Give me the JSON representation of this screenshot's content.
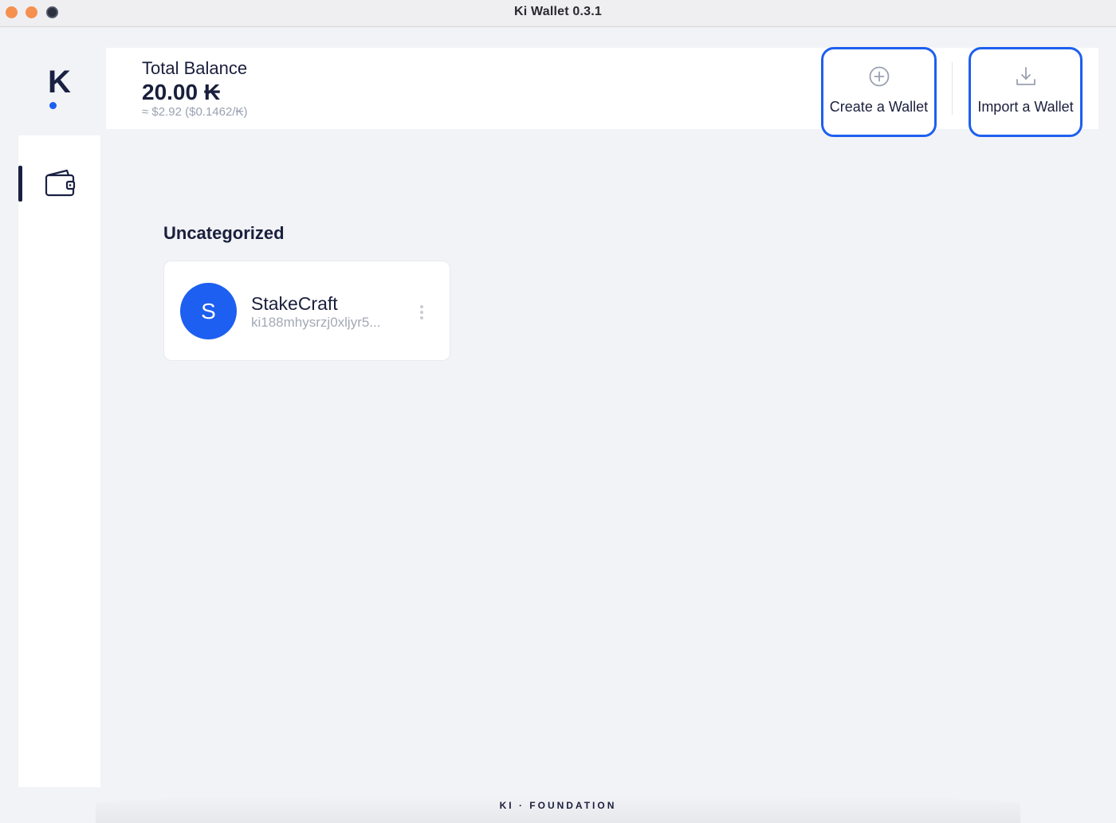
{
  "window": {
    "title": "Ki Wallet 0.3.1"
  },
  "logo": {
    "letter": "K"
  },
  "header": {
    "balance_title": "Total Balance",
    "balance_amount": "20.00 ₭",
    "balance_fiat": "≈ $2.92 ($0.1462/₭)",
    "create_label": "Create a Wallet",
    "import_label": "Import a Wallet"
  },
  "section": {
    "title": "Uncategorized"
  },
  "wallets": [
    {
      "initial": "S",
      "name": "StakeCraft",
      "address": "ki188mhysrzj0xljyr5..."
    }
  ],
  "footer": {
    "brand": "KI · FOUNDATION"
  },
  "colors": {
    "accent": "#1d5ff0",
    "navy": "#1a2043",
    "background": "#f2f3f6",
    "muted": "#9aa1b0"
  },
  "icons": {
    "sidebar": "wallet-icon",
    "create": "plus-circle-icon",
    "import": "download-icon",
    "wallet_menu": "more-vertical-icon"
  }
}
